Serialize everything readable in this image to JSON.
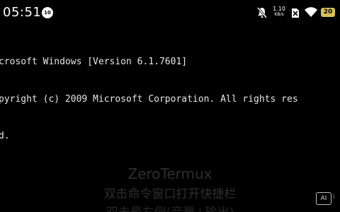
{
  "status_bar": {
    "time": "05:51",
    "notification_badge": "10",
    "net_speed_value": "1.10",
    "net_speed_unit": "KB/s",
    "battery_level": "20",
    "battery_color": "#d6c25a",
    "icons": [
      "mute-icon",
      "no-sim-icon",
      "wifi-icon",
      "battery-icon"
    ]
  },
  "terminal": {
    "lines": [
      "crosoft Windows [Version 6.1.7601]",
      "pyright (c) 2009 Microsoft Corporation. All rights res",
      "d."
    ],
    "prompt": "\\>"
  },
  "overlay": {
    "title": "ZeroTermux",
    "hint": "双击命令窗口打开快捷栏",
    "hint2": "双击最右侧(音量+输出)"
  },
  "ai_button": {
    "label": "AI"
  },
  "edge_label": "i"
}
